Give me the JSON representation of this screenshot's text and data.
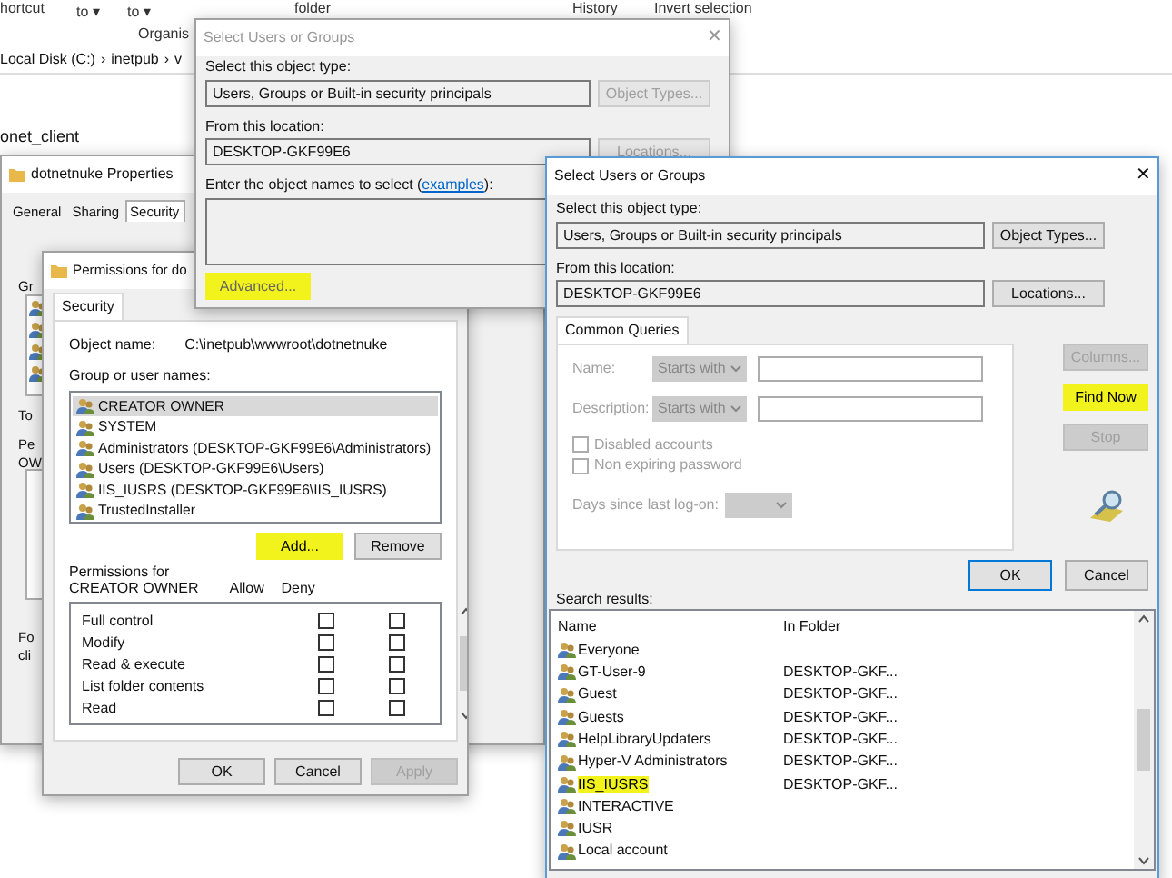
{
  "explorer": {
    "ribbon_labels": [
      "hortcut",
      "to ▾",
      "to ▾",
      "Organis",
      "folder",
      "History",
      "Invert selection"
    ],
    "breadcrumb": [
      "Local Disk (C:)",
      "›",
      "inetpub",
      "›",
      "v"
    ],
    "folder_item": "onet_client"
  },
  "properties_window": {
    "title": "dotnetnuke Properties",
    "tabs": [
      {
        "label": "General",
        "selected": false
      },
      {
        "label": "Sharing",
        "selected": false
      },
      {
        "label": "Security",
        "selected": true
      }
    ],
    "fragments": [
      "Gr",
      "To",
      "Pe",
      "OW",
      "Fo",
      "cli"
    ]
  },
  "permissions_window": {
    "title": "Permissions for do",
    "tabs": [
      {
        "label": "Security",
        "selected": true
      }
    ],
    "object_name_label": "Object name:",
    "object_name": "C:\\inetpub\\wwwroot\\dotnetnuke",
    "groups_label": "Group or user names:",
    "groups": [
      {
        "name": "CREATOR OWNER",
        "selected": true
      },
      {
        "name": "SYSTEM",
        "selected": false
      },
      {
        "name": "Administrators (DESKTOP-GKF99E6\\Administrators)",
        "selected": false
      },
      {
        "name": "Users (DESKTOP-GKF99E6\\Users)",
        "selected": false
      },
      {
        "name": "IIS_IUSRS (DESKTOP-GKF99E6\\IIS_IUSRS)",
        "selected": false
      },
      {
        "name": "TrustedInstaller",
        "selected": false
      }
    ],
    "group_buttons": [
      {
        "label": "Add...",
        "highlighted": true
      },
      {
        "label": "Remove",
        "highlighted": false
      }
    ],
    "permissions_label": "Permissions for CREATOR OWNER",
    "allow_label": "Allow",
    "deny_label": "Deny",
    "permissions": [
      {
        "name": "Full control",
        "allow": false,
        "deny": false
      },
      {
        "name": "Modify",
        "allow": false,
        "deny": false
      },
      {
        "name": "Read & execute",
        "allow": false,
        "deny": false
      },
      {
        "name": "List folder contents",
        "allow": false,
        "deny": false
      },
      {
        "name": "Read",
        "allow": false,
        "deny": false
      }
    ],
    "buttons": [
      {
        "label": "OK",
        "disabled": false
      },
      {
        "label": "Cancel",
        "disabled": false
      },
      {
        "label": "Apply",
        "disabled": true
      }
    ]
  },
  "back_dialog": {
    "title": "Select Users or Groups",
    "close": "✕",
    "object_type_label": "Select this object type:",
    "object_type": "Users, Groups or Built-in security principals",
    "object_types_button": "Object Types...",
    "location_label": "From this location:",
    "location": "DESKTOP-GKF99E6",
    "locations_button": "Locations...",
    "names_label_start": "Enter the object names to select (",
    "names_link": "examples",
    "names_label_end": "):",
    "advanced_button": {
      "label": "Advanced...",
      "highlighted": true
    }
  },
  "front_dialog": {
    "title": "Select Users or Groups",
    "close": "✕",
    "object_type_label": "Select this object type:",
    "object_type": "Users, Groups or Built-in security principals",
    "object_types_button": "Object Types...",
    "location_label": "From this location:",
    "location": "DESKTOP-GKF99E6",
    "locations_button": "Locations...",
    "query_tabs": [
      {
        "label": "Common Queries",
        "selected": true
      }
    ],
    "query_fields": [
      {
        "label": "Name:",
        "operator": "Starts with"
      },
      {
        "label": "Description:",
        "operator": "Starts with"
      }
    ],
    "options": [
      {
        "label": "Disabled accounts",
        "checked": false
      },
      {
        "label": "Non expiring password",
        "checked": false
      }
    ],
    "days_label": "Days since last log-on:",
    "side_buttons": [
      {
        "label": "Columns...",
        "disabled": true,
        "highlighted": false
      },
      {
        "label": "Find Now",
        "disabled": false,
        "highlighted": true
      },
      {
        "label": "Stop",
        "disabled": true,
        "highlighted": false
      }
    ],
    "buttons": [
      {
        "label": "OK",
        "default": true
      },
      {
        "label": "Cancel",
        "default": false
      }
    ],
    "results_label": "Search results:",
    "columns": [
      "Name",
      "In Folder"
    ],
    "results": [
      {
        "name": "Everyone",
        "highlighted": false
      },
      {
        "name": "GT-User-9",
        "folder": "DESKTOP-GKF...",
        "highlighted": false
      },
      {
        "name": "Guest",
        "folder": "DESKTOP-GKF...",
        "highlighted": false
      },
      {
        "name": "Guests",
        "folder": "DESKTOP-GKF...",
        "highlighted": false
      },
      {
        "name": "HelpLibraryUpdaters",
        "folder": "DESKTOP-GKF...",
        "highlighted": false
      },
      {
        "name": "Hyper-V Administrators",
        "folder": "DESKTOP-GKF...",
        "highlighted": false
      },
      {
        "name": "IIS_IUSRS",
        "folder": "DESKTOP-GKF...",
        "highlighted": true
      },
      {
        "name": "INTERACTIVE",
        "highlighted": false
      },
      {
        "name": "IUSR",
        "highlighted": false
      },
      {
        "name": "Local account",
        "highlighted": false
      }
    ]
  }
}
